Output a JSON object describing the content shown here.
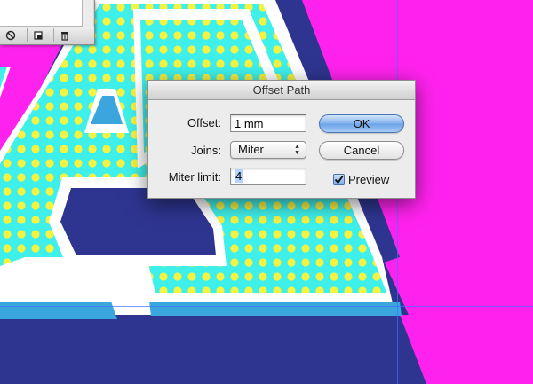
{
  "dialog": {
    "title": "Offset Path",
    "offset_label": "Offset:",
    "offset_value": "1 mm",
    "joins_label": "Joins:",
    "joins_value": "Miter",
    "miter_label": "Miter limit:",
    "miter_value": "4",
    "ok_label": "OK",
    "cancel_label": "Cancel",
    "preview_label": "Preview",
    "preview_checked": true
  },
  "panel": {
    "buttons": [
      "no-symbol-icon",
      "new-swatch-icon",
      "trash-icon"
    ]
  },
  "colors": {
    "background": "#ff22ee",
    "letter_shadow": "#2e3590",
    "letter_outline": "#ffffff",
    "letter_stroke": "#3aa6dd",
    "letter_fill": "#3ff0ea",
    "dots": "#f6f241",
    "accent": "#6aa2e8"
  }
}
